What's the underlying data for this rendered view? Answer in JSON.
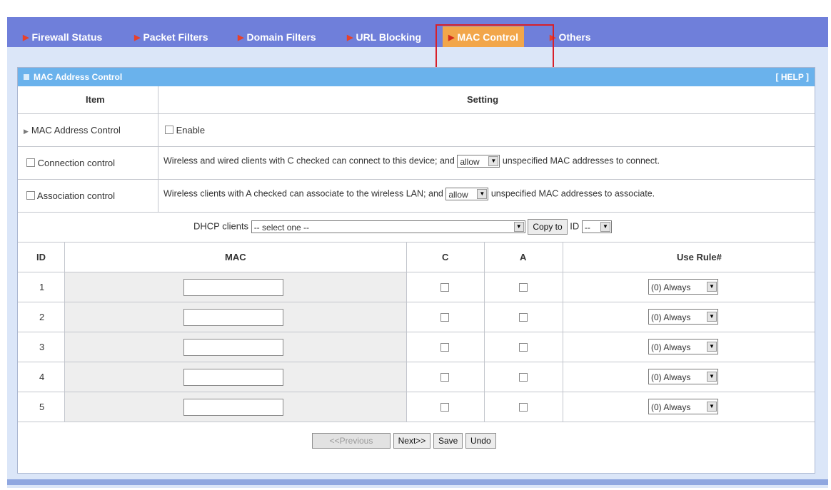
{
  "tabs": [
    {
      "label": "Firewall Status",
      "active": false
    },
    {
      "label": "Packet Filters",
      "active": false
    },
    {
      "label": "Domain Filters",
      "active": false
    },
    {
      "label": "URL Blocking",
      "active": false
    },
    {
      "label": "MAC Control",
      "active": true
    },
    {
      "label": "Others",
      "active": false
    }
  ],
  "section": {
    "title": "MAC Address Control",
    "help": "[ HELP ]"
  },
  "table_header": {
    "item": "Item",
    "setting": "Setting"
  },
  "mac_control": {
    "label": "MAC Address Control",
    "enable_label": "Enable"
  },
  "connection": {
    "label": "Connection control",
    "text_before": "Wireless and wired clients with C checked can connect to this device; and",
    "select_value": "allow",
    "text_after": "unspecified MAC addresses to connect."
  },
  "association": {
    "label": "Association control",
    "text_before": "Wireless clients with A checked can associate to the wireless LAN; and",
    "select_value": "allow",
    "text_after": "unspecified MAC addresses to associate."
  },
  "dhcp": {
    "label": "DHCP clients",
    "select_value": "-- select one --",
    "copy_button": "Copy to",
    "id_label": "ID",
    "id_value": "--"
  },
  "grid_header": {
    "id": "ID",
    "mac": "MAC",
    "c": "C",
    "a": "A",
    "rule": "Use Rule#"
  },
  "rows": [
    {
      "id": "1",
      "mac": "",
      "rule": "(0) Always"
    },
    {
      "id": "2",
      "mac": "",
      "rule": "(0) Always"
    },
    {
      "id": "3",
      "mac": "",
      "rule": "(0) Always"
    },
    {
      "id": "4",
      "mac": "",
      "rule": "(0) Always"
    },
    {
      "id": "5",
      "mac": "",
      "rule": "(0) Always"
    }
  ],
  "buttons": {
    "previous": "<<Previous",
    "next": "Next>>",
    "save": "Save",
    "undo": "Undo"
  }
}
